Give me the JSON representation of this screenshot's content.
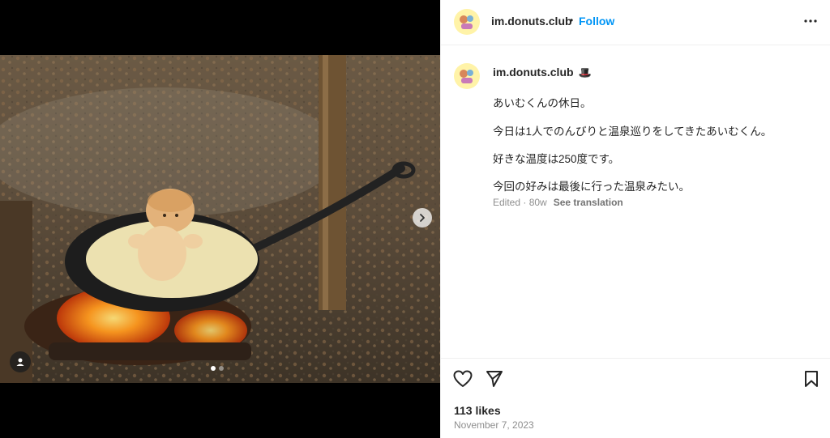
{
  "post": {
    "username": "im.donuts.club",
    "separator": "•",
    "follow_label": "Follow",
    "badge_emoji": "🎩",
    "caption_lines": [
      "あいむくんの休日。",
      "今日は1人でのんびりと温泉巡りをしてきたあいむくん。",
      "好きな温度は250度です。",
      "今回の好みは最後に行った温泉みたい。"
    ],
    "edited_label": "Edited · 80w",
    "see_translation": "See translation",
    "likes": "113 likes",
    "date": "November 7, 2023"
  },
  "media": {
    "carousel_total": 2,
    "carousel_active": 1
  },
  "icons": {
    "more": "more-horizontal-icon",
    "like": "heart-icon",
    "share": "send-icon",
    "save": "bookmark-icon",
    "next": "chevron-right-icon",
    "tag": "user-tag-icon"
  },
  "colors": {
    "accent": "#0095f6",
    "text": "#262626",
    "muted": "#8e8e8e"
  }
}
